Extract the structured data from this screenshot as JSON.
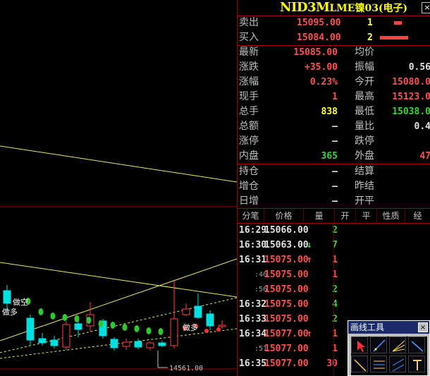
{
  "chart": {
    "low_label": "14561.00",
    "annotations": {
      "short": "做空",
      "long1": "做多",
      "long2": "做多"
    }
  },
  "header": {
    "code": "NID3M",
    "name": "LME镍03(电子)",
    "close": "×"
  },
  "orderbook": {
    "sell": {
      "label": "卖出",
      "price": "15095.00",
      "volume": "1",
      "bar_frac": 0.5
    },
    "buy": {
      "label": "买入",
      "price": "15084.00",
      "volume": "2",
      "bar_frac": 1.0
    }
  },
  "stats": [
    {
      "l1": "最新",
      "v1": "15085.00",
      "c1": "red",
      "l2": "均价",
      "v2": "",
      "c2": "white"
    },
    {
      "l1": "涨跌",
      "v1": "+35.00",
      "c1": "red",
      "l2": "振幅",
      "v2": "0.56",
      "c2": "white"
    },
    {
      "l1": "涨幅",
      "v1": "0.23%",
      "c1": "red",
      "l2": "今开",
      "v2": "15080.0",
      "c2": "red"
    },
    {
      "l1": "现手",
      "v1": "1",
      "c1": "red",
      "l2": "最高",
      "v2": "15123.0",
      "c2": "red"
    },
    {
      "l1": "总手",
      "v1": "838",
      "c1": "yellow",
      "l2": "最低",
      "v2": "15038.0",
      "c2": "green"
    },
    {
      "l1": "总额",
      "v1": "–",
      "c1": "white",
      "l2": "量比",
      "v2": "0.4",
      "c2": "white"
    },
    {
      "l1": "涨停",
      "v1": "–",
      "c1": "white",
      "l2": "跌停",
      "v2": "",
      "c2": "white"
    },
    {
      "l1": "内盘",
      "v1": "365",
      "c1": "green",
      "l2": "外盘",
      "v2": "47",
      "c2": "red"
    }
  ],
  "positions": [
    {
      "l1": "持仓",
      "v1": "–",
      "l2": "结算",
      "v2": ""
    },
    {
      "l1": "增仓",
      "v1": "–",
      "l2": "昨结",
      "v2": ""
    },
    {
      "l1": "日增",
      "v1": "–",
      "l2": "开平",
      "v2": ""
    }
  ],
  "ticks_header": [
    "分笔",
    "价格",
    "量",
    "开",
    "平",
    "性质",
    "经"
  ],
  "ticks": [
    {
      "time": "16:29",
      "price": "15066.00",
      "arrow": "",
      "vol": "2",
      "pc": "white",
      "vc": "green"
    },
    {
      "time": "16:30",
      "price": "15063.00",
      "arrow": "↓",
      "vol": "7",
      "pc": "white",
      "vc": "green"
    },
    {
      "time": "16:31",
      "price": "15075.00",
      "arrow": "↑",
      "vol": "1",
      "pc": "red",
      "vc": "red"
    },
    {
      "time": ":46",
      "price": "15075.00",
      "arrow": "",
      "vol": "1",
      "pc": "red",
      "vc": "red"
    },
    {
      "time": ":56",
      "price": "15075.00",
      "arrow": "",
      "vol": "2",
      "pc": "red",
      "vc": "green"
    },
    {
      "time": "16:32",
      "price": "15075.00",
      "arrow": "",
      "vol": "4",
      "pc": "red",
      "vc": "green"
    },
    {
      "time": "16:33",
      "price": "15075.00",
      "arrow": "",
      "vol": "2",
      "pc": "red",
      "vc": "green"
    },
    {
      "time": "16:34",
      "price": "15077.00",
      "arrow": "↑",
      "vol": "1",
      "pc": "red",
      "vc": "red"
    },
    {
      "time": ":51",
      "price": "15077.00",
      "arrow": "",
      "vol": "1",
      "pc": "red",
      "vc": "red"
    },
    {
      "time": "16:35",
      "price": "15077.00",
      "arrow": "",
      "vol": "30",
      "pc": "red",
      "vc": "red"
    }
  ],
  "draw_tools": {
    "title": "画线工具",
    "close": "×",
    "tools": [
      "pointer-tool-icon",
      "ray-line-icon",
      "fan-line-icon",
      "trend-line-icon",
      "segment-line-icon",
      "fibonacci-icon",
      "channel-icon",
      "text-tool-icon"
    ]
  },
  "colors": {
    "accent_red": "#ff5050",
    "up_green": "#3cd23c",
    "title_yellow": "#ffff00",
    "divider": "#a00000"
  }
}
